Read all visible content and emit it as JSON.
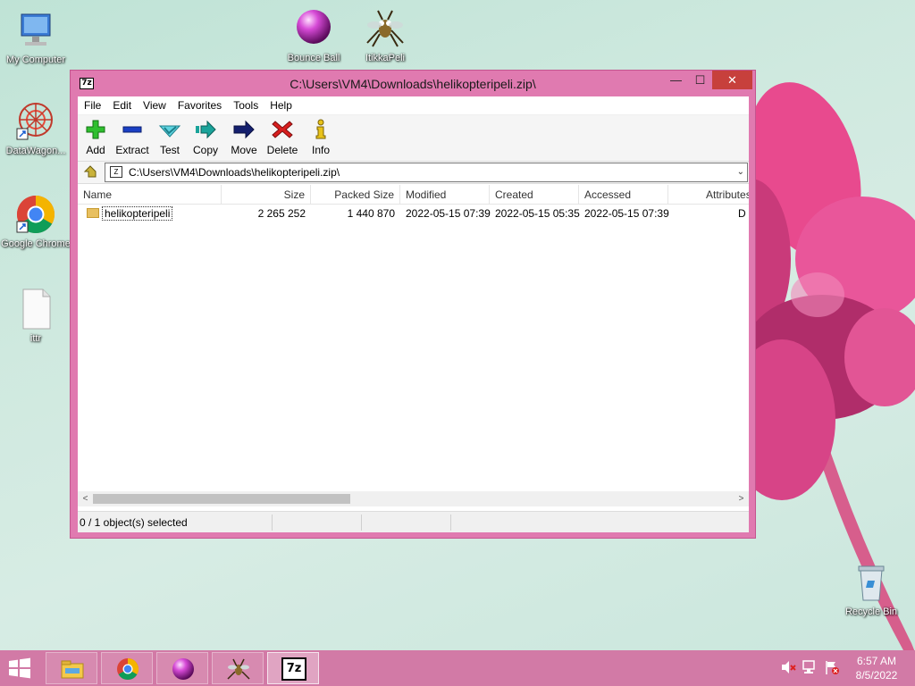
{
  "desktop": {
    "icons": [
      {
        "label": "My Computer"
      },
      {
        "label": "DataWagon..."
      },
      {
        "label": "Google Chrome"
      },
      {
        "label": "ittr"
      },
      {
        "label": "Bounce Ball"
      },
      {
        "label": "ItikkaPeli"
      },
      {
        "label": "Recycle Bin"
      }
    ]
  },
  "window": {
    "title": "C:\\Users\\VM4\\Downloads\\helikopteripeli.zip\\",
    "app_icon_text": "7z",
    "controls": {
      "minimize": "—",
      "maximize": "☐",
      "close": "✕"
    },
    "menu": [
      "File",
      "Edit",
      "View",
      "Favorites",
      "Tools",
      "Help"
    ],
    "toolbar": [
      {
        "label": "Add",
        "icon": "plus-icon"
      },
      {
        "label": "Extract",
        "icon": "minus-icon"
      },
      {
        "label": "Test",
        "icon": "check-icon"
      },
      {
        "label": "Copy",
        "icon": "copy-arrow-icon"
      },
      {
        "label": "Move",
        "icon": "move-arrow-icon"
      },
      {
        "label": "Delete",
        "icon": "delete-x-icon"
      },
      {
        "label": "Info",
        "icon": "info-icon"
      }
    ],
    "address": {
      "path": "C:\\Users\\VM4\\Downloads\\helikopteripeli.zip\\",
      "dropdown": "⌄"
    },
    "columns": [
      "Name",
      "Size",
      "Packed Size",
      "Modified",
      "Created",
      "Accessed",
      "Attributes"
    ],
    "rows": [
      {
        "name": "helikopteripeli",
        "size": "2 265 252",
        "packed_size": "1 440 870",
        "modified": "2022-05-15 07:39",
        "created": "2022-05-15 05:35",
        "accessed": "2022-05-15 07:39",
        "attributes": "D"
      }
    ],
    "scroll": {
      "left": "<",
      "right": ">"
    },
    "status": "0 / 1 object(s) selected"
  },
  "taskbar": {
    "apps": [
      {
        "name": "file-explorer-icon"
      },
      {
        "name": "chrome-icon"
      },
      {
        "name": "bounce-ball-icon"
      },
      {
        "name": "itikkapeli-icon"
      },
      {
        "name": "7zip-icon",
        "text": "7z"
      }
    ],
    "clock": {
      "time": "6:57 AM",
      "date": "8/5/2022"
    }
  },
  "colors": {
    "accent": "#d27aa6",
    "window_frame": "#e07ab0",
    "close": "#c7403c"
  }
}
